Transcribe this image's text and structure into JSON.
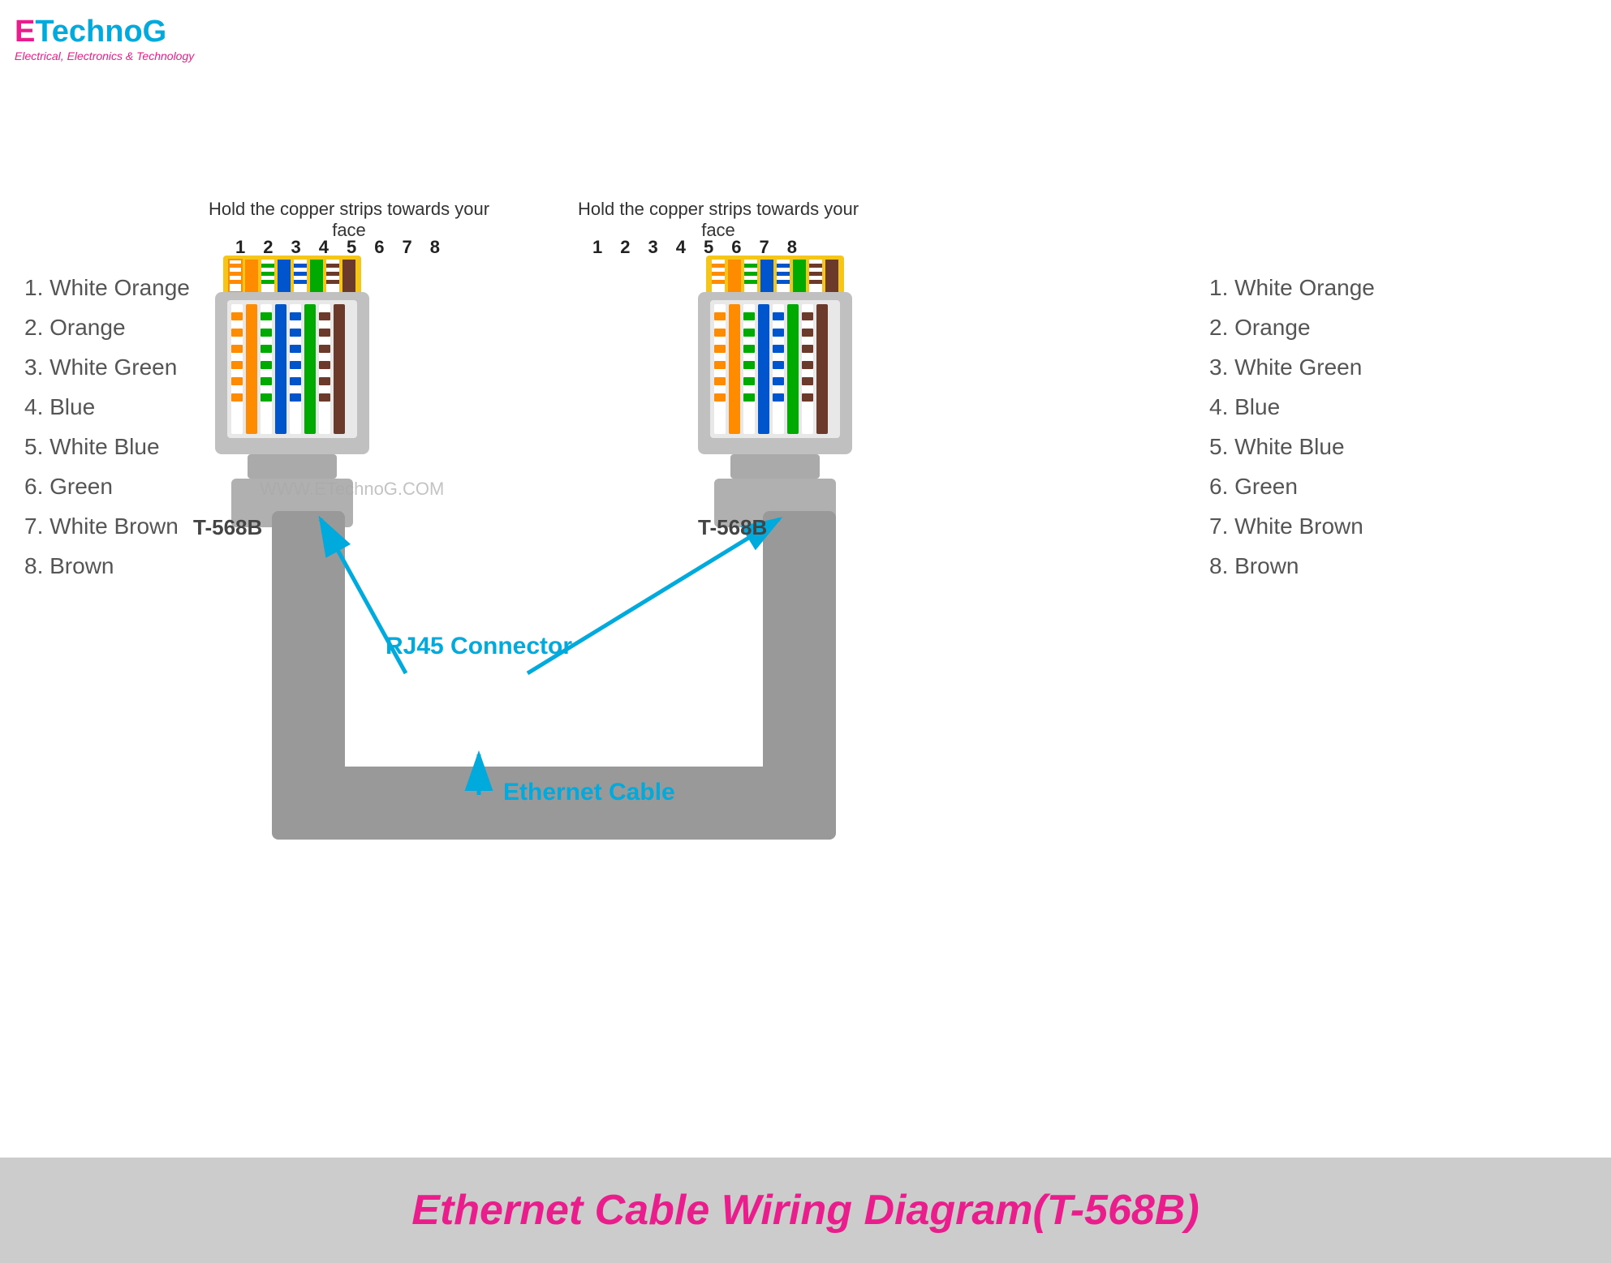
{
  "logo": {
    "e": "E",
    "technog": "TechnoG",
    "tagline": "Electrical, Electronics & Technology"
  },
  "hold_text": "Hold the copper strips towards your face",
  "pin_numbers": "1 2 3 4 5 6 7 8",
  "wire_list": [
    "1.  White Orange",
    "2.  Orange",
    "3.  White Green",
    "4.  Blue",
    "5.  White Blue",
    "6.  Green",
    "7.  White Brown",
    "8.  Brown"
  ],
  "label_standard": "T-568B",
  "label_connector": "RJ45 Connector",
  "label_cable": "Ethernet Cable",
  "watermark": "WWW.ETechnoG.COM",
  "footer_title": "Ethernet Cable Wiring Diagram(T-568B)"
}
